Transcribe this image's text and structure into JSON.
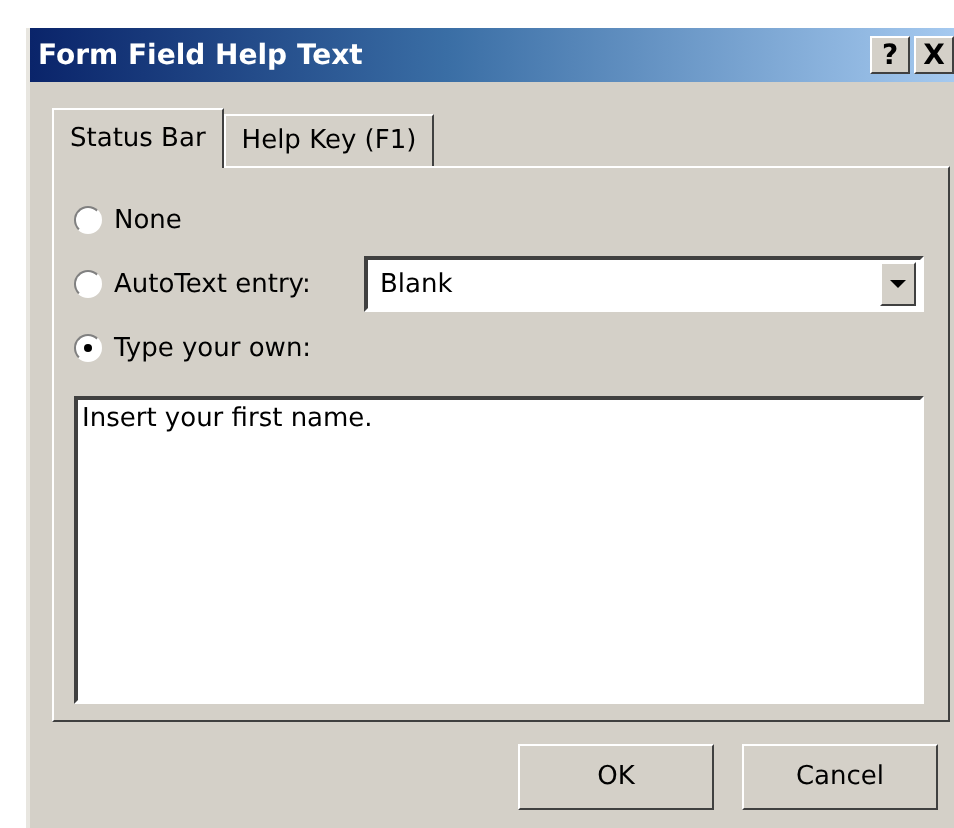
{
  "window": {
    "title": "Form Field Help Text",
    "help_button": "?",
    "close_button": "X"
  },
  "tabs": [
    {
      "label": "Status Bar",
      "selected": true
    },
    {
      "label": "Help Key (F1)",
      "selected": false
    }
  ],
  "options": [
    {
      "label": "None",
      "selected": false
    },
    {
      "label": "AutoText entry:",
      "selected": false,
      "dropdown": {
        "value": "Blank"
      }
    },
    {
      "label": "Type your own:",
      "selected": true
    }
  ],
  "text": {
    "value": "Insert your first name."
  },
  "buttons": [
    "OK",
    "Cancel"
  ]
}
